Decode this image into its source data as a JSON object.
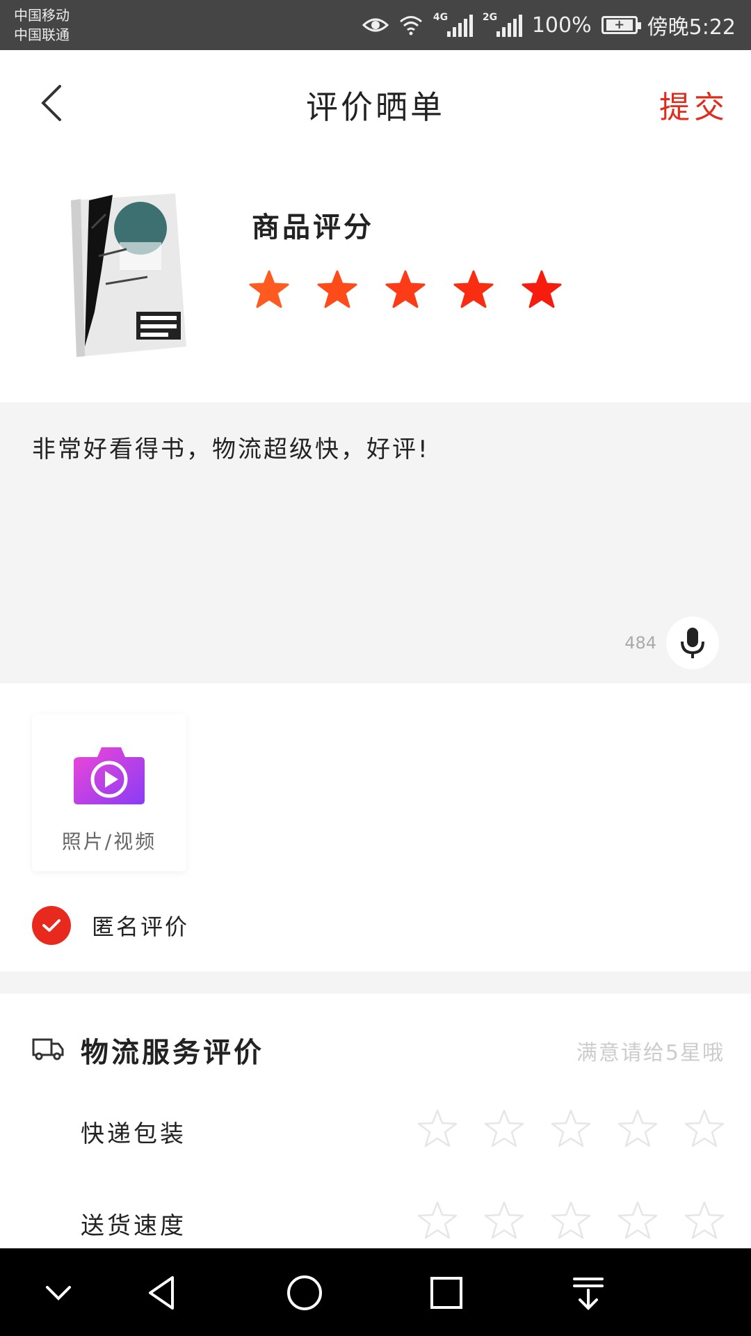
{
  "status_bar": {
    "carrier1": "中国移动",
    "carrier2": "中国联通",
    "network1": "4G",
    "network2": "2G",
    "battery": "100%",
    "time": "傍晚5:22"
  },
  "header": {
    "title": "评价晒单",
    "submit_label": "提交",
    "back_icon": "chevron-left-icon"
  },
  "product": {
    "rating_label": "商品评分",
    "rating": 5,
    "max_rating": 5,
    "star_colors": [
      "#ff5a1f",
      "#fd4c1a",
      "#fb3c16",
      "#f92d12",
      "#f71d0e"
    ]
  },
  "review": {
    "text": "非常好看得书，物流超级快，好评!",
    "remaining": "484",
    "mic_icon": "microphone-icon"
  },
  "media": {
    "label": "照片/视频",
    "icon": "camera-video-icon"
  },
  "anonymous": {
    "label": "匿名评价",
    "checked": true
  },
  "logistics": {
    "title": "物流服务评价",
    "hint": "满意请给5星哦",
    "rows": [
      {
        "label": "快递包装",
        "rating": 0
      },
      {
        "label": "送货速度",
        "rating": 0
      }
    ]
  },
  "colors": {
    "accent": "#e12b1b",
    "box_bg": "#f4f4f4"
  }
}
